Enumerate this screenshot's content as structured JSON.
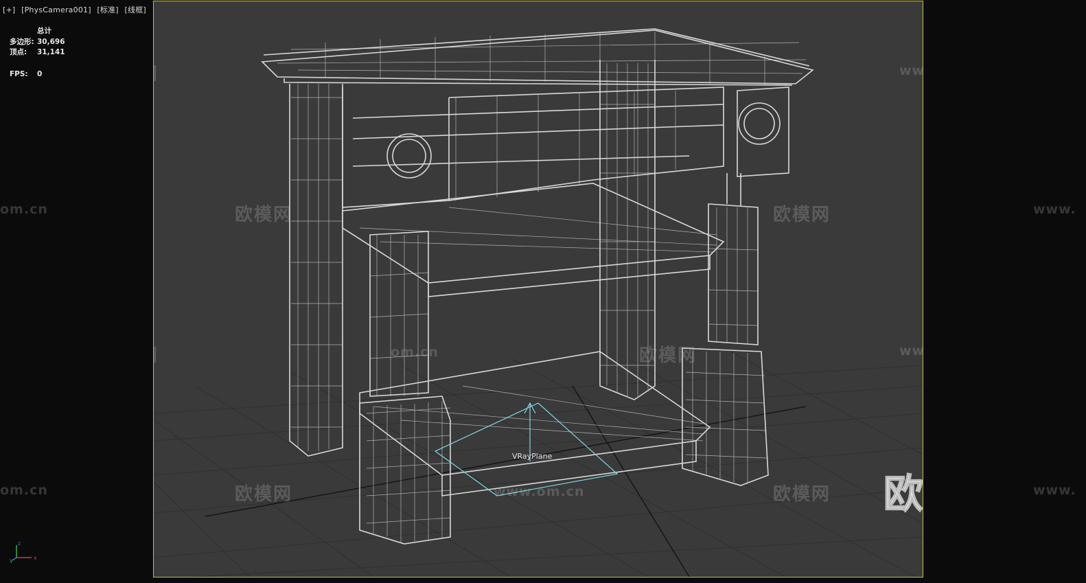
{
  "viewport_label": {
    "plus": "[+]",
    "camera": "[PhysCamera001]",
    "shading": "[标准]",
    "mode": "[线框]"
  },
  "stats": {
    "total_header": "总计",
    "polygons_label": "多边形:",
    "polygons_value": "30,696",
    "vertices_label": "顶点:",
    "vertices_value": "31,141",
    "fps_label": "FPS:",
    "fps_value": "0"
  },
  "scene": {
    "object_label": "VRayPlane"
  },
  "axis_gizmo": {
    "x": "x",
    "y": "y",
    "z": "z"
  },
  "watermarks": {
    "cn": "欧模网",
    "url": "www.om.cn",
    "url_partial_left": "om.cn",
    "url_partial_right": "www.",
    "url_partial_center": "www.om.cn",
    "big_logo": "欧模网"
  },
  "colors": {
    "viewport_bg": "#3a3a3a",
    "viewport_border": "#c9c530",
    "wireframe": "#d9d9d9",
    "grid": "#2d2d2d",
    "vray_plane": "#7fd6e6"
  }
}
